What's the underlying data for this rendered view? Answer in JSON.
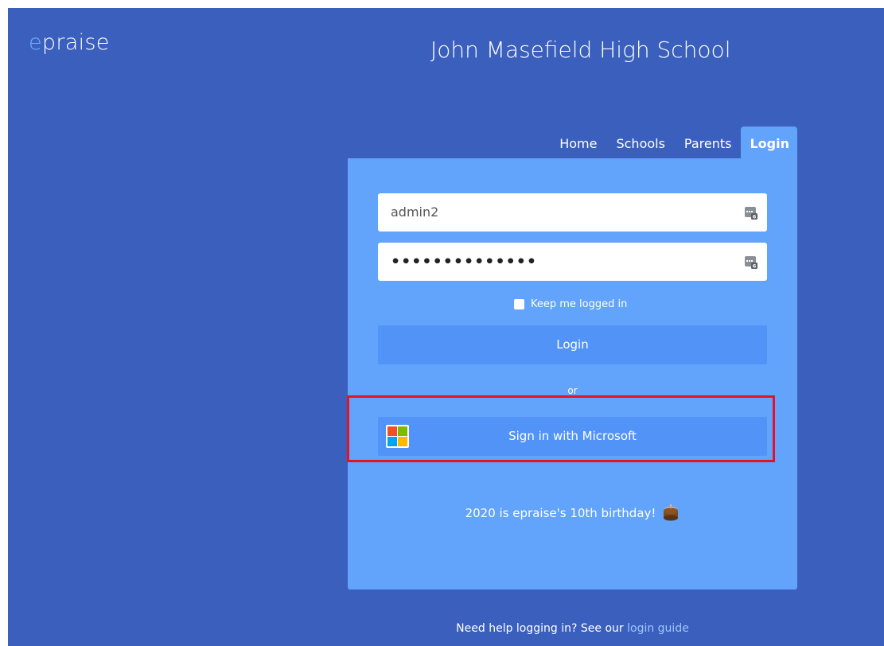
{
  "brand": {
    "logo_first": "e",
    "logo_rest": "praise"
  },
  "header": {
    "school_name": "John Masefield High School"
  },
  "nav": {
    "items": [
      {
        "label": "Home"
      },
      {
        "label": "Schools"
      },
      {
        "label": "Parents"
      },
      {
        "label": "Login",
        "active": true
      }
    ]
  },
  "login_form": {
    "username_value": "admin2",
    "password_mask": "••••••••••••••",
    "remember_label": "Keep me logged in",
    "login_button": "Login",
    "or_text": "or",
    "microsoft_button": "Sign in with Microsoft",
    "password_manager_icon": "password-manager-icon"
  },
  "announcement": {
    "text": "2020 is epraise's 10th birthday!",
    "icon": "cake-icon"
  },
  "footer": {
    "help_text": "Need help logging in? See our",
    "help_link": "login guide"
  },
  "colors": {
    "page_background": "#3b5fbd",
    "panel_background": "#62a3fb",
    "button_background": "#5293f8",
    "highlight_border": "#e81123",
    "logo_accent": "#6fb0ff"
  }
}
